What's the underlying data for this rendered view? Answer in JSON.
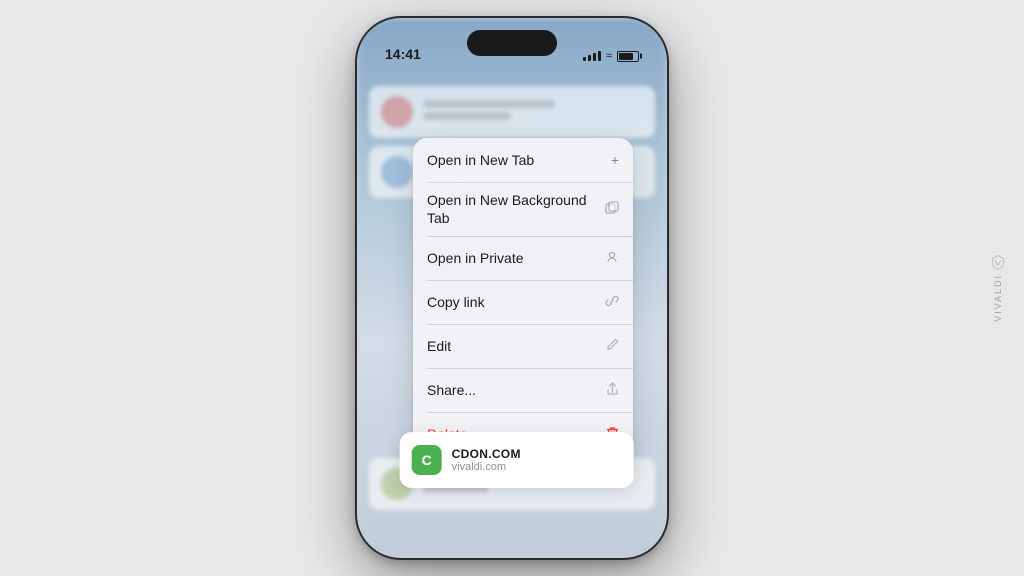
{
  "page": {
    "background_color": "#e8e8ea"
  },
  "watermark": {
    "text": "VIVALDI"
  },
  "status_bar": {
    "time": "14:41"
  },
  "context_menu": {
    "items": [
      {
        "id": "open-new-tab",
        "label": "Open in New Tab",
        "icon": "+",
        "color": "normal"
      },
      {
        "id": "open-background-tab",
        "label": "Open in New Background Tab",
        "icon": "⊕",
        "color": "normal"
      },
      {
        "id": "open-private",
        "label": "Open in Private",
        "icon": "👻",
        "color": "normal"
      },
      {
        "id": "copy-link",
        "label": "Copy link",
        "icon": "⚇",
        "color": "normal"
      },
      {
        "id": "edit",
        "label": "Edit",
        "icon": "✎",
        "color": "normal"
      },
      {
        "id": "share",
        "label": "Share...",
        "icon": "⬆",
        "color": "normal"
      },
      {
        "id": "delete",
        "label": "Delete",
        "icon": "🗑",
        "color": "delete"
      }
    ]
  },
  "preview_card": {
    "favicon_letter": "C",
    "favicon_color": "#4caf50",
    "title": "CDON.COM",
    "url": "vivaldi.com"
  }
}
